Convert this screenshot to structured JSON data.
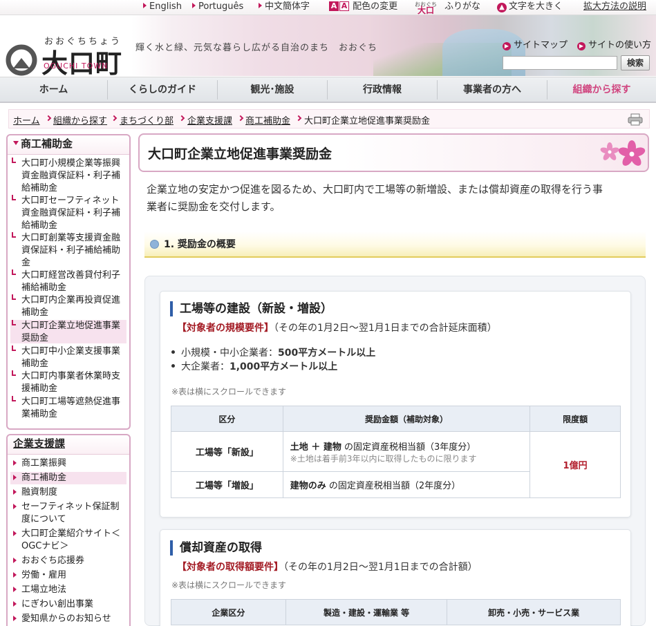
{
  "topbar": {
    "english": "English",
    "portugues": "Português",
    "chinese": "中文簡体字",
    "color_label": "配色の変更",
    "furigana_ruby": "おおぐち",
    "furigana_brand": "大口",
    "furigana_label": "ふりがな",
    "enlarge_label": "文字を大きく",
    "zoom_help": "拡大方法の説明",
    "aa_a": "A",
    "aa_b": "A"
  },
  "header": {
    "logo_ruby": "おおぐちちょう",
    "logo_text": "大口町",
    "logo_en": "OGUCHI TOWN",
    "tagline": "輝く水と緑、元気な暮らし広がる自治のまち　おおぐち",
    "sitemap": "サイトマップ",
    "howto": "サイトの使い方",
    "search_button": "検索",
    "search_value": ""
  },
  "nav": {
    "items": [
      "ホーム",
      "くらしのガイド",
      "観光･施設",
      "行政情報",
      "事業者の方へ",
      "組織から探す"
    ]
  },
  "breadcrumb": {
    "items": [
      "ホーム",
      "組織から探す",
      "まちづくり部",
      "企業支援課",
      "商工補助金",
      "大口町企業立地促進事業奨励金"
    ]
  },
  "sidebar": {
    "box1_title": "商工補助金",
    "box1_items": [
      [
        "大口町小規模企業等振興",
        "資金融資保証料・利子補",
        "給補助金"
      ],
      [
        "大口町セーフティネット",
        "資金融資保証料・利子補",
        "給補助金"
      ],
      [
        "大口町創業等支援資金融",
        "資保証料・利子補給補助",
        "金"
      ],
      [
        "大口町経営改善貸付利子",
        "補給補助金"
      ],
      [
        "大口町内企業再投資促進",
        "補助金"
      ],
      [
        "大口町企業立地促進事業",
        "奨励金"
      ],
      [
        "大口町中小企業支援事業",
        "補助金"
      ],
      [
        "大口町内事業者休業時支",
        "援補助金"
      ],
      [
        "大口町工場等遮熱促進事",
        "業補助金"
      ]
    ],
    "box2_title": "企業支援課",
    "box2_items": [
      [
        "商工業振興"
      ],
      [
        "商工補助金"
      ],
      [
        "融資制度"
      ],
      [
        "セーフティネット保証制",
        "度について"
      ],
      [
        "大口町企業紹介サイト＜",
        "OGCナビ＞"
      ],
      [
        "おおぐち応援券"
      ],
      [
        "労働・雇用"
      ],
      [
        "工場立地法"
      ],
      [
        "にぎわい創出事業"
      ],
      [
        "愛知県からのお知らせ"
      ]
    ]
  },
  "main": {
    "title": "大口町企業立地促進事業奨励金",
    "intro_line1": "企業立地の安定かつ促進を図るため、大口町内で工場等の新増設、または償却資産の取得を行う事",
    "intro_line2": "業者に奨励金を交付します。",
    "section1": "1. 奨励金の概要",
    "card1": {
      "heading": "工場等の建設（新設・増設）",
      "req_bold": "【対象者の規模要件】",
      "req_rest": "（その年の1月2日～翌1月1日までの合計延床面積）",
      "bullet1_pre": "小規模・中小企業者：",
      "bullet1_bold": "500平方メートル以上",
      "bullet2_pre": "大企業者：",
      "bullet2_bold": "1,000平方メートル以上",
      "note": "※表は横にスクロールできます",
      "headers": [
        "区分",
        "奨励金額（補助対象）",
        "限度額"
      ],
      "row1_label": "工場等「新設」",
      "row1_bold": "土地 ＋ 建物",
      "row1_rest": " の固定資産税相当額（3年度分）",
      "row1_note": "※土地は着手前3年以内に取得したものに限ります",
      "row2_label": "工場等「増設」",
      "row2_bold": "建物のみ",
      "row2_rest": " の固定資産税相当額（2年度分）",
      "limit": "1億円"
    },
    "card2": {
      "heading": "償却資産の取得",
      "req_bold": "【対象者の取得額要件】",
      "req_rest": "（その年の1月2日～翌1月1日までの合計額）",
      "note": "※表は横にスクロールできます",
      "headers": [
        "企業区分",
        "製造・建設・運輸業 等",
        "卸売・小売・サービス業"
      ]
    }
  },
  "colors": {
    "accent": "#c2185b",
    "pink_border": "#d8a8c4",
    "heading_bar": "#2f5ea8",
    "limit_red": "#b21f2d"
  },
  "icons": [
    "arrow-icon",
    "color-aa-icon",
    "up-circle-icon",
    "link-circle-icon",
    "chevron-right-icon",
    "printer-icon",
    "sakura-icon",
    "section-dot-icon"
  ]
}
